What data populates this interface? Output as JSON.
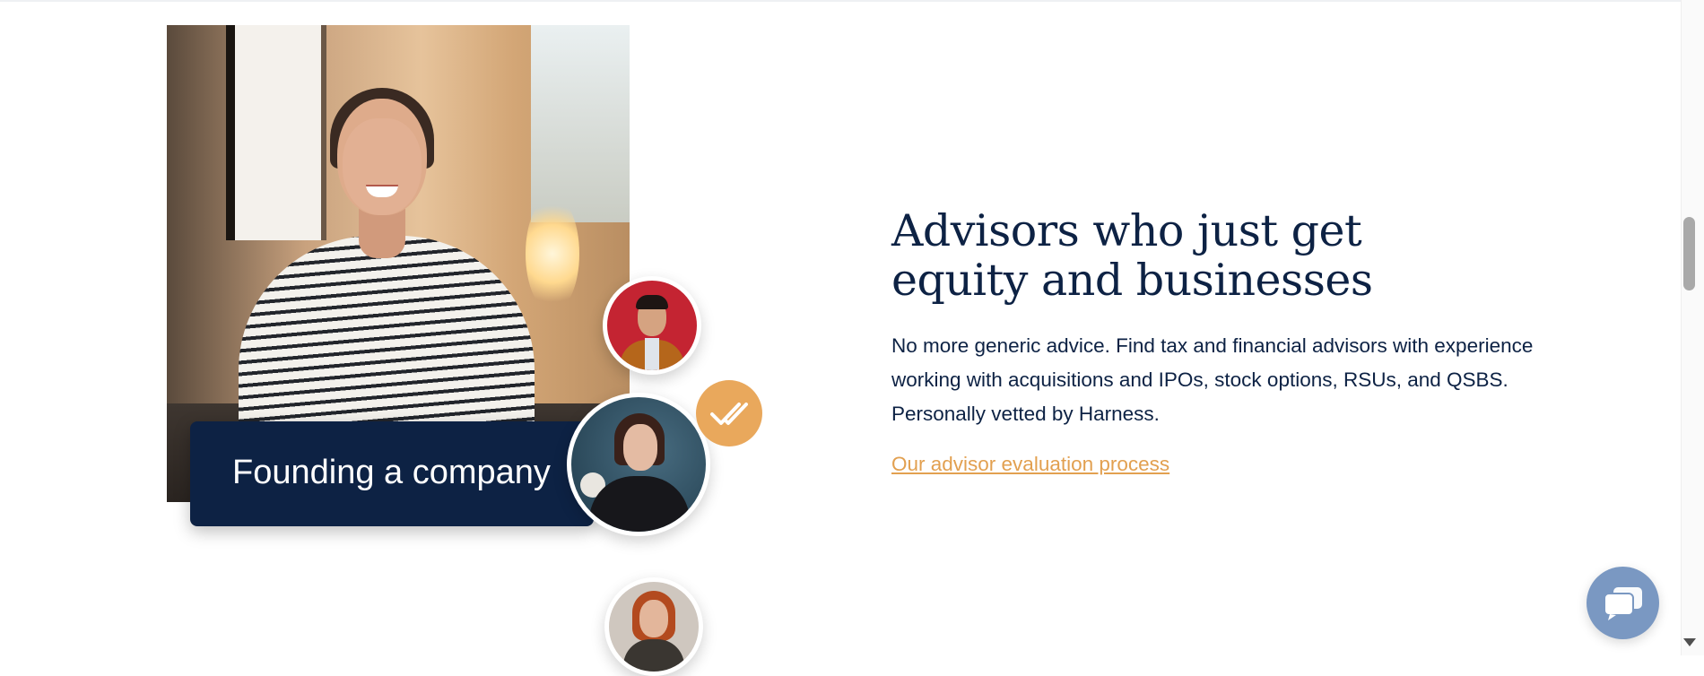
{
  "caption": {
    "label": "Founding a company"
  },
  "section": {
    "heading": "Advisors who just get equity and businesses",
    "body": "No more generic advice. Find tax and financial advisors with experience working with acquisitions and IPOs, stock options, RSUs, and QSBS. Personally vetted by Harness.",
    "link_label": "Our advisor evaluation process"
  },
  "icons": {
    "check_badge": "check-icon",
    "chat": "chat-bubble-icon",
    "scroll_down": "arrow-down-icon"
  },
  "colors": {
    "navy": "#0d2244",
    "accent_orange": "#e9a85c",
    "link_orange": "#e2a050",
    "chat_blue": "#7a98c2"
  }
}
